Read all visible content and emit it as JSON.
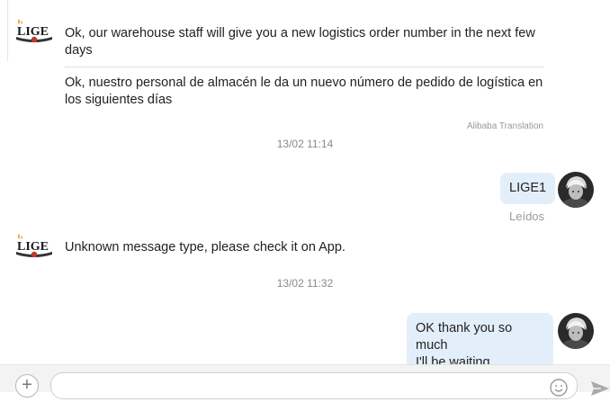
{
  "messages": {
    "first": {
      "sender_logo": "LIGE",
      "text": "Ok, our warehouse staff will give you a new logistics order number in the next few days",
      "translation": "Ok, nuestro personal de almacén le da un nuevo número de pedido de logística en los siguientes días",
      "translation_source": "Alibaba Translation"
    },
    "timestamp_1": "13/02 11:14",
    "sent_1": {
      "text": "LIGE1",
      "status": "Leídos"
    },
    "second": {
      "sender_logo": "LIGE",
      "text": "Unknown message type, please check it on App."
    },
    "timestamp_2": "13/02 11:32",
    "sent_2": {
      "line1": "OK thank you so much",
      "line2": "I'll be waiting"
    }
  },
  "composer": {
    "plus_icon": "plus-icon",
    "emoji_icon": "emoji-icon",
    "send_icon": "send-icon",
    "input_value": ""
  },
  "colors": {
    "outgoing_bubble": "#e3eefb",
    "logo_red": "#c0392b",
    "logo_orange": "#f39c12",
    "muted_text": "#8a8a8a"
  }
}
